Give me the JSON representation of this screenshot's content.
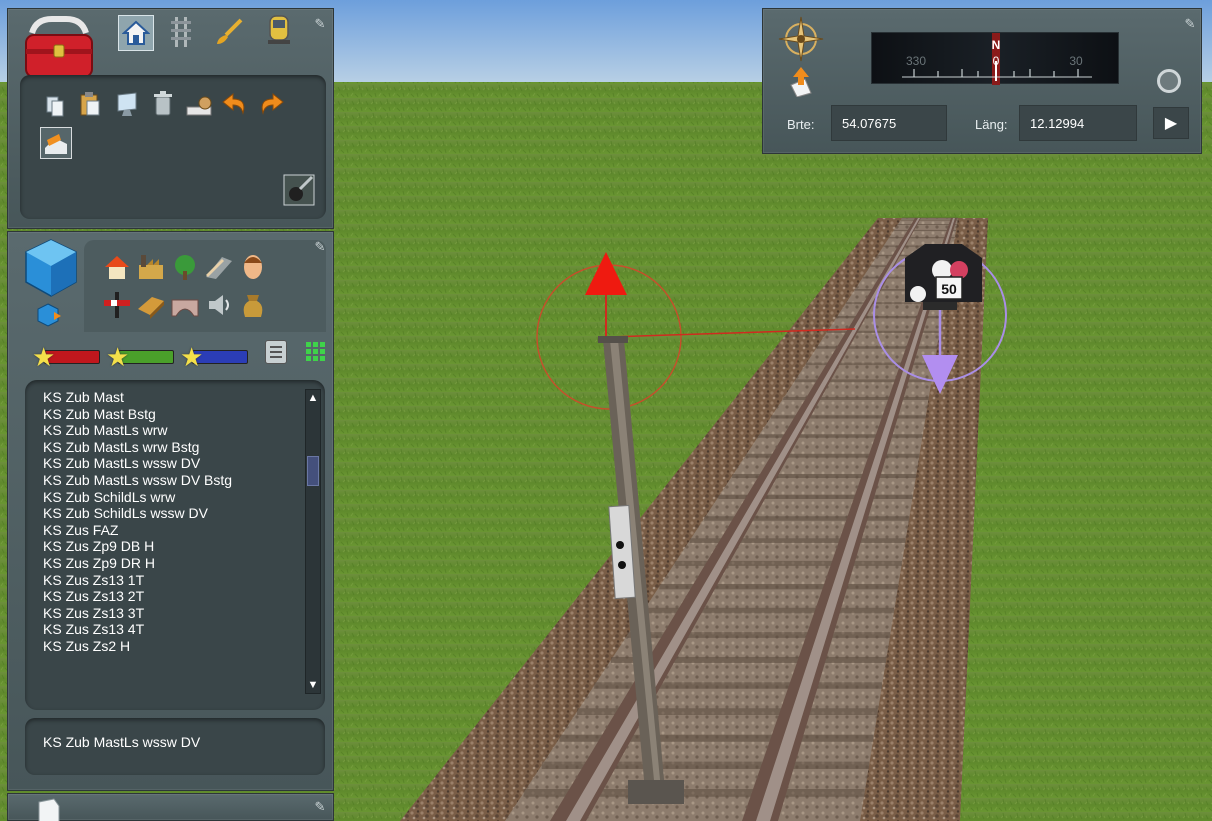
{
  "toolbar": {
    "toolbox_icon": "toolbox-icon",
    "tabs": [
      {
        "icon": "home-icon"
      },
      {
        "icon": "track-icon"
      },
      {
        "icon": "paintbrush-icon"
      },
      {
        "icon": "train-icon"
      }
    ],
    "tools": [
      {
        "icon": "copy-icon"
      },
      {
        "icon": "paste-icon"
      },
      {
        "icon": "monitor-icon"
      },
      {
        "icon": "trash-icon"
      },
      {
        "icon": "measure-icon"
      },
      {
        "icon": "undo-icon"
      },
      {
        "icon": "redo-icon"
      }
    ],
    "extra_tool": {
      "icon": "landscape-tool-icon"
    },
    "brush_tool": {
      "icon": "brush-selector-icon"
    }
  },
  "objects_panel": {
    "category_tabs": [
      {
        "icon": "house-icon"
      },
      {
        "icon": "factory-icon"
      },
      {
        "icon": "tree-icon"
      },
      {
        "icon": "road-icon"
      },
      {
        "icon": "person-icon"
      },
      {
        "icon": "signal-icon"
      },
      {
        "icon": "platform-icon"
      },
      {
        "icon": "bridge-icon"
      },
      {
        "icon": "speaker-icon"
      },
      {
        "icon": "bag-icon"
      }
    ],
    "filter_buttons": [
      {
        "color": "#c0171d"
      },
      {
        "color": "#4aa02a"
      },
      {
        "color": "#2b3db6"
      }
    ],
    "view_modes": [
      {
        "icon": "list-view-icon"
      },
      {
        "icon": "grid-view-icon"
      }
    ],
    "items": [
      "KS Zub Mast",
      "KS Zub Mast Bstg",
      "KS Zub MastLs wrw",
      "KS Zub MastLs wrw Bstg",
      "KS Zub MastLs wssw DV",
      "KS Zub MastLs wssw DV Bstg",
      "KS Zub SchildLs wrw",
      "KS Zub SchildLs wssw DV",
      "KS Zus FAZ",
      "KS Zus Zp9 DB H",
      "KS Zus Zp9 DR H",
      "KS Zus Zs13 1T",
      "KS Zus Zs13 2T",
      "KS Zus Zs13 3T",
      "KS Zus Zs13 4T",
      "KS Zus Zs2 H"
    ],
    "selected": "KS Zub MastLs wssw DV"
  },
  "navigation": {
    "compass": {
      "left_heading": "330",
      "center_letter": "N",
      "center_heading": "0",
      "right_heading": "30"
    },
    "latitude_label": "Brte:",
    "latitude_value": "54.07675",
    "longitude_label": "Läng:",
    "longitude_value": "12.12994"
  },
  "scene": {
    "speed_sign": "50",
    "colors": {
      "sky": "#86b3e2",
      "grass": "#6a8f32",
      "ballast": "#7b5f48",
      "rail": "#8a7a70",
      "handle_red": "#e0201a",
      "handle_purple": "#a98ee6"
    }
  }
}
